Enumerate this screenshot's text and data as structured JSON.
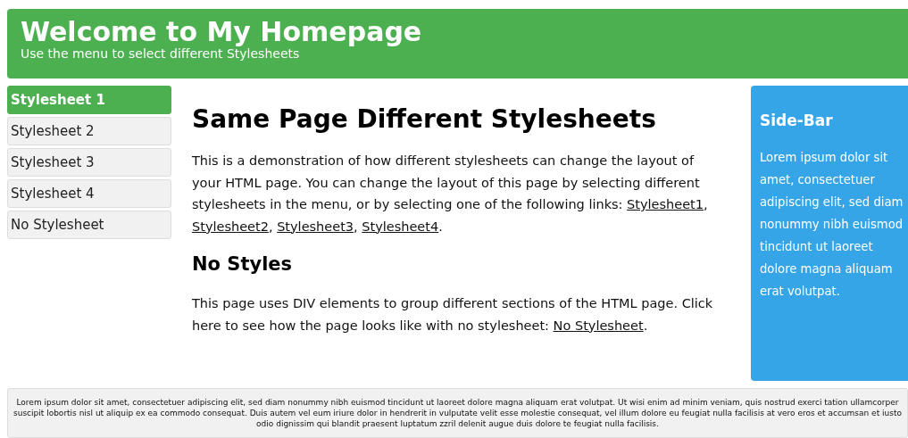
{
  "header": {
    "title": "Welcome to My Homepage",
    "subtitle": "Use the menu to select different Stylesheets"
  },
  "menu": [
    {
      "label": "Stylesheet 1",
      "selected": true
    },
    {
      "label": "Stylesheet 2",
      "selected": false
    },
    {
      "label": "Stylesheet 3",
      "selected": false
    },
    {
      "label": "Stylesheet 4",
      "selected": false
    },
    {
      "label": "No Stylesheet",
      "selected": false
    }
  ],
  "main": {
    "heading": "Same Page Different Stylesheets",
    "intro": [
      {
        "kind": "text",
        "text": "This is a demonstration of how different stylesheets can change the layout of your HTML page. You can change the layout of this page by selecting different stylesheets in the menu, or by selecting one of the following links: "
      },
      {
        "kind": "link",
        "text": "Stylesheet1"
      },
      {
        "kind": "text",
        "text": ", "
      },
      {
        "kind": "link",
        "text": "Stylesheet2"
      },
      {
        "kind": "text",
        "text": ", "
      },
      {
        "kind": "link",
        "text": "Stylesheet3"
      },
      {
        "kind": "text",
        "text": ", "
      },
      {
        "kind": "link",
        "text": "Stylesheet4"
      },
      {
        "kind": "text",
        "text": "."
      }
    ],
    "subheading": "No Styles",
    "body": [
      {
        "kind": "text",
        "text": "This page uses DIV elements to group different sections of the HTML page. Click here to see how the page looks like with no stylesheet: "
      },
      {
        "kind": "link",
        "text": "No Stylesheet"
      },
      {
        "kind": "text",
        "text": "."
      }
    ]
  },
  "sidebar": {
    "title": "Side-Bar",
    "text": "Lorem ipsum dolor sit amet, consectetuer adipiscing elit, sed diam nonummy nibh euismod tincidunt ut laoreet dolore magna aliquam erat volutpat."
  },
  "footer": "Lorem ipsum dolor sit amet, consectetuer adipiscing elit, sed diam nonummy nibh euismod tincidunt ut laoreet dolore magna aliquam erat volutpat. Ut wisi enim ad minim veniam, quis nostrud exerci tation ullamcorper suscipit lobortis nisl ut aliquip ex ea commodo consequat. Duis autem vel eum iriure dolor in hendrerit in vulputate velit esse molestie consequat, vel illum dolore eu feugiat nulla facilisis at vero eros et accumsan et iusto odio dignissim qui blandit praesent luptatum zzril delenit augue duis dolore te feugiat nulla facilisis."
}
